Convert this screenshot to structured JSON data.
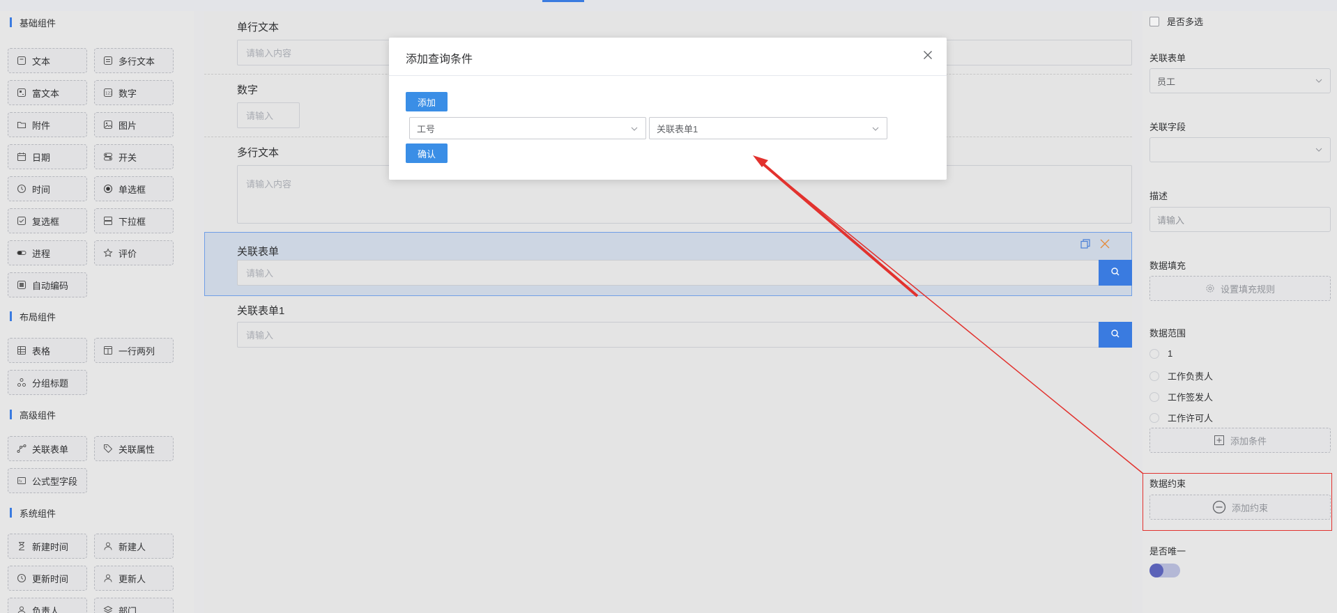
{
  "left_panel": {
    "groups": [
      {
        "title": "基础组件",
        "items": [
          {
            "label": "文本",
            "icon": "text-icon"
          },
          {
            "label": "多行文本",
            "icon": "textarea-icon"
          },
          {
            "label": "富文本",
            "icon": "richtext-icon"
          },
          {
            "label": "数字",
            "icon": "number-icon"
          },
          {
            "label": "附件",
            "icon": "folder-icon"
          },
          {
            "label": "图片",
            "icon": "image-icon"
          },
          {
            "label": "日期",
            "icon": "calendar-icon"
          },
          {
            "label": "开关",
            "icon": "switch-icon"
          },
          {
            "label": "时间",
            "icon": "clock-icon"
          },
          {
            "label": "单选框",
            "icon": "radio-icon"
          },
          {
            "label": "复选框",
            "icon": "checkbox-icon"
          },
          {
            "label": "下拉框",
            "icon": "dropdown-icon"
          },
          {
            "label": "进程",
            "icon": "progress-icon"
          },
          {
            "label": "评价",
            "icon": "star-icon"
          },
          {
            "label": "自动编码",
            "icon": "autocode-icon"
          }
        ]
      },
      {
        "title": "布局组件",
        "items": [
          {
            "label": "表格",
            "icon": "table-icon"
          },
          {
            "label": "一行两列",
            "icon": "two-column-icon"
          },
          {
            "label": "分组标题",
            "icon": "group-title-icon"
          }
        ]
      },
      {
        "title": "高级组件",
        "items": [
          {
            "label": "关联表单",
            "icon": "link-form-icon"
          },
          {
            "label": "关联属性",
            "icon": "tag-icon"
          },
          {
            "label": "公式型字段",
            "icon": "formula-icon"
          }
        ]
      },
      {
        "title": "系统组件",
        "items": [
          {
            "label": "新建时间",
            "icon": "hourglass-icon"
          },
          {
            "label": "新建人",
            "icon": "user-icon"
          },
          {
            "label": "更新时间",
            "icon": "clock-icon"
          },
          {
            "label": "更新人",
            "icon": "user-update-icon"
          },
          {
            "label": "负责人",
            "icon": "user-icon"
          },
          {
            "label": "部门",
            "icon": "layers-icon"
          }
        ]
      }
    ]
  },
  "canvas": {
    "fields": [
      {
        "label": "单行文本",
        "placeholder": "请输入内容"
      },
      {
        "label": "数字",
        "placeholder": "请输入"
      },
      {
        "label": "多行文本",
        "placeholder": "请输入内容"
      },
      {
        "label": "关联表单",
        "placeholder": "请输入"
      },
      {
        "label": "关联表单1",
        "placeholder": "请输入"
      }
    ]
  },
  "modal": {
    "title": "添加查询条件",
    "add_label": "添加",
    "confirm_label": "确认",
    "field_select": "工号",
    "value_select": "关联表单1"
  },
  "right_panel": {
    "multi_select_label": "是否多选",
    "link_form_label": "关联表单",
    "link_form_value": "员工",
    "link_field_label": "关联字段",
    "link_field_value": "",
    "desc_label": "描述",
    "desc_placeholder": "请输入",
    "fill_label": "数据填充",
    "fill_button": "设置填充规则",
    "range_label": "数据范围",
    "range_options": [
      "1",
      "工作负责人",
      "工作签发人",
      "工作许可人"
    ],
    "add_condition": "添加条件",
    "constraint_label": "数据约束",
    "add_constraint": "添加约束",
    "unique_label": "是否唯一"
  },
  "colors": {
    "accent": "#3a7be0",
    "annotation_red": "#e2322e"
  }
}
